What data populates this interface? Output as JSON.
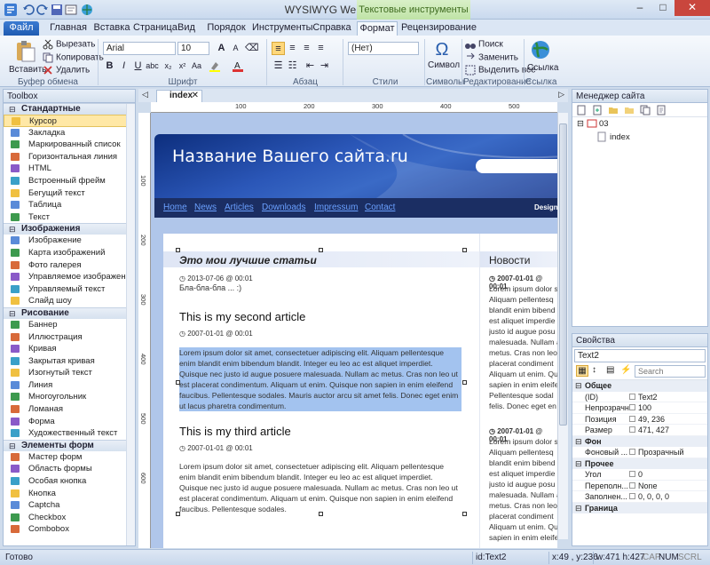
{
  "window": {
    "title": "WYSIWYG Web Builder - [03]",
    "context_group": "Текстовые инструменты",
    "controls": [
      "–",
      "□",
      "✕"
    ]
  },
  "ribbon_tabs": [
    "Файл",
    "Главная",
    "Вставка",
    "Страница",
    "Вид",
    "Порядок",
    "Инструменты",
    "Справка",
    "Формат",
    "Рецензирование"
  ],
  "ribbon": {
    "clipboard": {
      "paste": "Вставить",
      "cut": "Вырезать",
      "copy": "Копировать",
      "delete": "Удалить",
      "label": "Буфер обмена"
    },
    "font": {
      "family": "Arial",
      "size": "10",
      "label": "Шрифт",
      "bold": "B",
      "italic": "I",
      "underline": "U",
      "grow": "A",
      "shrink": "A"
    },
    "paragraph": {
      "label": "Абзац"
    },
    "styles": {
      "value": "(Нет)",
      "label": "Стили"
    },
    "symbols": {
      "symbol": "Символ",
      "label": "Символы",
      "glyph": "Ω"
    },
    "editing": {
      "find": "Поиск",
      "replace": "Заменить",
      "select_all": "Выделить всё",
      "label": "Редактирование"
    },
    "links": {
      "link": "Ссылка",
      "label": "Ссылка"
    }
  },
  "toolbox": {
    "title": "Toolbox",
    "categories": [
      {
        "name": "Стандартные",
        "items": [
          "Курсор",
          "Закладка",
          "Маркированный список",
          "Горизонтальная линия",
          "HTML",
          "Встроенный фрейм",
          "Бегущий текст",
          "Таблица",
          "Текст"
        ]
      },
      {
        "name": "Изображения",
        "items": [
          "Изображение",
          "Карта изображений",
          "Фото галерея",
          "Управляемое изображение",
          "Управляемый текст",
          "Слайд шоу"
        ]
      },
      {
        "name": "Рисование",
        "items": [
          "Баннер",
          "Иллюстрация",
          "Кривая",
          "Закрытая кривая",
          "Изогнутый текст",
          "Линия",
          "Многоугольник",
          "Ломаная",
          "Форма",
          "Художественный текст"
        ]
      },
      {
        "name": "Элементы форм",
        "items": [
          "Мастер форм",
          "Область формы",
          "Особая кнопка",
          "Кнопка",
          "Captcha",
          "Checkbox",
          "Combobox"
        ]
      }
    ],
    "selected": "Курсор"
  },
  "document": {
    "tab": "index"
  },
  "ruler": {
    "top": [
      "100",
      "200",
      "300",
      "400",
      "500",
      "600"
    ],
    "left": [
      "100",
      "200",
      "300",
      "400",
      "500",
      "600"
    ]
  },
  "site": {
    "title": "Название Вашего сайта.ru",
    "nav": [
      "Home",
      "News",
      "Articles",
      "Downloads",
      "Impressum",
      "Contact"
    ],
    "designed": "Designe",
    "section_title": "Это мои лучшие статьи",
    "section_date": "2013-07-06 @ 00:01",
    "section_text": "Бла-бла-бла ... :)",
    "articles": [
      {
        "title": "This is my second article",
        "date": "2007-01-01 @ 00:01",
        "text": "Lorem ipsum dolor sit amet, consectetuer adipiscing elit. Aliquam pellentesque enim blandit enim bibendum blandit. Integer eu leo ac est aliquet imperdiet. Quisque nec justo id augue posuere malesuada. Nullam ac metus. Cras non leo ut est placerat condimentum. Aliquam ut enim. Quisque non sapien in enim eleifend faucibus. Pellentesque sodales. Mauris auctor arcu sit amet felis. Donec eget enim ut lacus pharetra condimentum."
      },
      {
        "title": "This is my third article",
        "date": "2007-01-01 @ 00:01",
        "text": "Lorem ipsum dolor sit amet, consectetuer adipiscing elit. Aliquam pellentesque enim blandit enim bibendum blandit. Integer eu leo ac est aliquet imperdiet. Quisque nec justo id augue posuere malesuada. Nullam ac metus. Cras non leo ut est placerat condimentum. Aliquam ut enim. Quisque non sapien in enim eleifend faucibus. Pellentesque sodales."
      }
    ],
    "news_title": "Новости",
    "news": [
      {
        "date": "2007-01-01 @ 00:01",
        "text": "Lorem ipsum dolor sit Aliquam pellentesq blandit enim bibend est aliquet imperdie justo id augue posu malesuada. Nullam a metus. Cras non leo placerat condiment Aliquam ut enim. Qu sapien in enim eleife Pellentesque sodal felis. Donec eget en"
      },
      {
        "date": "2007-01-01 @ 00:01",
        "text": "Lorem ipsum dolor sit Aliquam pellentesq blandit enim bibend est aliquet imperdie justo id augue posu malesuada. Nullam a metus. Cras non leo placerat condiment Aliquam ut enim. Qu sapien in enim eleife"
      }
    ]
  },
  "site_manager": {
    "title": "Менеджер сайта",
    "root": "03",
    "pages": [
      "index"
    ]
  },
  "properties": {
    "title": "Свойства",
    "object": "Text2",
    "search_placeholder": "Search",
    "groups": [
      {
        "name": "Общее",
        "rows": [
          {
            "k": "(ID)",
            "v": "Text2"
          },
          {
            "k": "Непрозрачн",
            "v": "100"
          },
          {
            "k": "Позиция",
            "v": "49, 236"
          },
          {
            "k": "Размер",
            "v": "471, 427"
          }
        ]
      },
      {
        "name": "Фон",
        "rows": [
          {
            "k": "Фоновый ...",
            "v": "Прозрачный"
          }
        ]
      },
      {
        "name": "Прочее",
        "rows": [
          {
            "k": "Угол",
            "v": "0"
          },
          {
            "k": "Переполн...",
            "v": "None"
          },
          {
            "k": "Заполнен...",
            "v": "0, 0, 0, 0"
          }
        ]
      },
      {
        "name": "Граница",
        "rows": []
      }
    ]
  },
  "status": {
    "left": "Готово",
    "id": "id:Text2",
    "coords": "x:49 , y:236",
    "size": "w:471 h:427",
    "caps": "CAP",
    "num": "NUM",
    "scrl": "SCRL"
  }
}
